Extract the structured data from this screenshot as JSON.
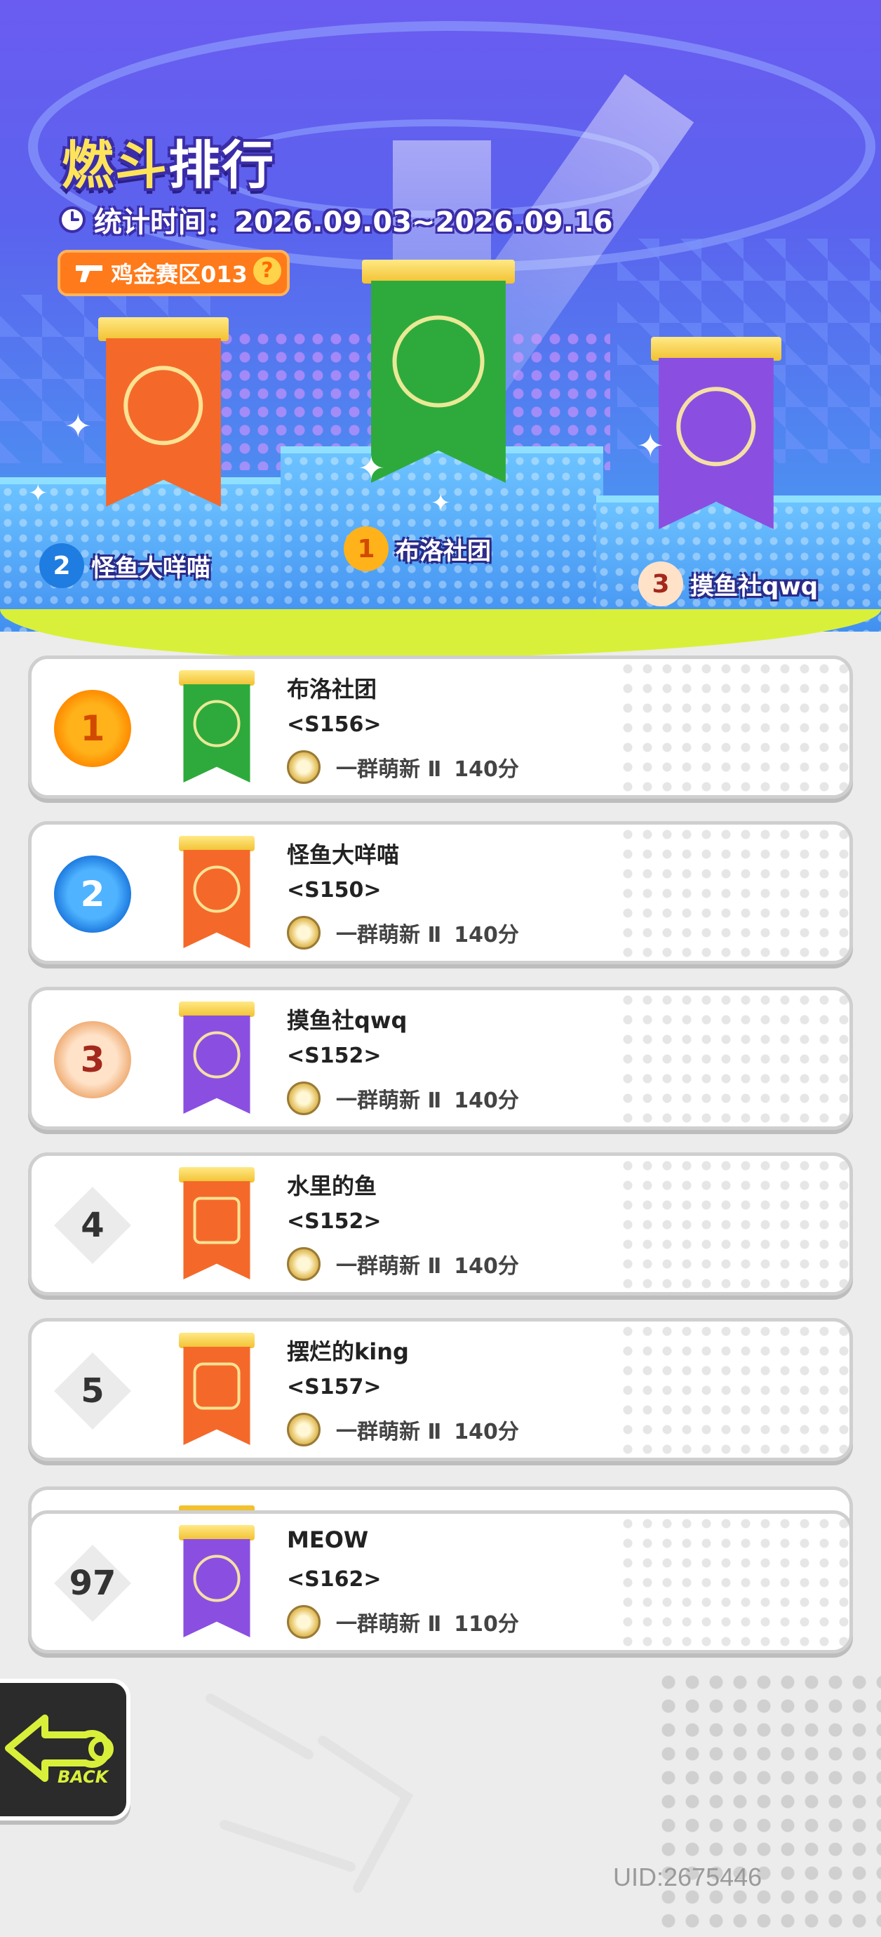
{
  "header": {
    "title_highlight": "燃斗",
    "title_rest": "排行",
    "date_label": "统计时间：2026.09.03~2026.09.16",
    "region": "鸡金赛区013",
    "help_symbol": "?"
  },
  "podium": [
    {
      "place": "1",
      "name": "布洛社团",
      "color": "#2eaa3c"
    },
    {
      "place": "2",
      "name": "怪鱼大咩喵",
      "color": "#f4692a"
    },
    {
      "place": "3",
      "name": "摸鱼社qwq",
      "color": "#8a4fe0"
    }
  ],
  "rankings": [
    {
      "rank": "1",
      "name": "布洛社团",
      "server": "<S156>",
      "level": "一群萌新 Ⅱ",
      "score": "140分",
      "banner_color": "#2eaa3c",
      "emblem": "wrench-emblem"
    },
    {
      "rank": "2",
      "name": "怪鱼大咩喵",
      "server": "<S150>",
      "level": "一群萌新 Ⅱ",
      "score": "140分",
      "banner_color": "#f4692a",
      "emblem": "fish-emblem"
    },
    {
      "rank": "3",
      "name": "摸鱼社qwq",
      "server": "<S152>",
      "level": "一群萌新 Ⅱ",
      "score": "140分",
      "banner_color": "#8a4fe0",
      "emblem": "angel-emblem"
    },
    {
      "rank": "4",
      "name": "水里的鱼",
      "server": "<S152>",
      "level": "一群萌新 Ⅱ",
      "score": "140分",
      "banner_color": "#f4692a",
      "emblem": "square-emblem"
    },
    {
      "rank": "5",
      "name": "摆烂的king",
      "server": "<S157>",
      "level": "一群萌新 Ⅱ",
      "score": "140分",
      "banner_color": "#f4692a",
      "emblem": "tv-emblem"
    }
  ],
  "my_rank": {
    "rank": "97",
    "name": "MEOW",
    "server": "<S162>",
    "level": "一群萌新 Ⅱ",
    "score": "110分",
    "banner_color": "#8a4fe0",
    "emblem": "fish-emblem"
  },
  "footer": {
    "back_label": "BACK",
    "uid": "UID:2675446"
  },
  "icons": {
    "clock": "clock-icon",
    "region": "gun-icon",
    "help": "help-icon",
    "level": "level-badge-icon",
    "back": "back-arrow-icon"
  },
  "colors": {
    "gold": "#ffb21a",
    "silver": "#1f7ce0",
    "bronze": "#f0b07a",
    "accent": "#d9f03a"
  }
}
